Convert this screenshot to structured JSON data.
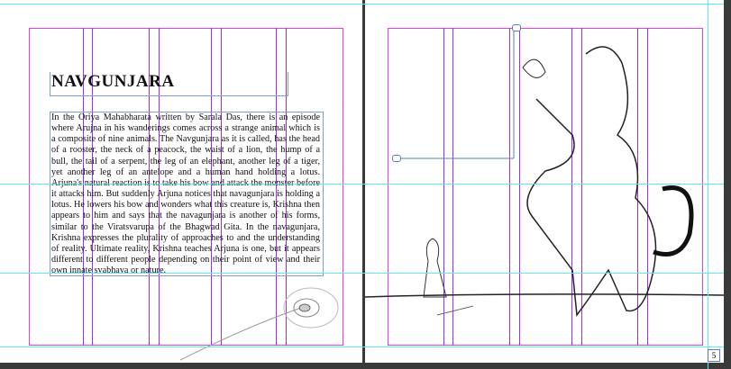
{
  "spread": {
    "title": "NAVGUNJARA",
    "body": "In the Oriya Mahabharata written by Sarala Das, there is an episode where Arujna in his wanderings comes across a strange animal which is a composite of nine animals. The Navgunjara as it is called, has the head of a rooster, the neck of a peacock, the waist of a lion, the hump of a bull, the tail of a serpent, the leg of an elephant, another leg of a tiger, yet another leg of an antelope and a human hand holding a lotus. Arjuna's natural reaction is to take his bow and attack the monster before it attacks him. But suddenly Arjuna notices that navagunjara is holding a lotus. He lowers his bow and wonders what this creature is, Krishna then appears to him and says that the navagunjara is another of his forms, similar to the Viratsvarupa of the Bhagwad Gita. In the navagunjara, Krishna expresses the plurality of approaches to and the understanding of reality. Ultimate reality, Krishna teaches Arjuna is one, but it appears different to different people depending on their point of view and their own innate svabhava or nature.",
    "page_number": "5"
  },
  "colors": {
    "margin": "#e040e8",
    "column": "#9b30e0",
    "guide": "#5fe8f0",
    "frame": "#7aa0d0"
  }
}
